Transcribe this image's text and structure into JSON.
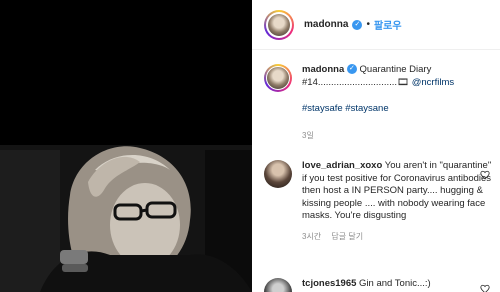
{
  "header": {
    "username": "madonna",
    "verified_mark": "✓",
    "separator": "•",
    "follow_label": "팔로우"
  },
  "caption": {
    "username": "madonna",
    "verified_mark": "✓",
    "text": "Quarantine Diary #14..............................",
    "emoji": "🎞",
    "mention": "@ncrfilms",
    "hashtags": "#staysafe #staysane",
    "time": "3일"
  },
  "comments": [
    {
      "username": "love_adrian_xoxo",
      "text": "You aren't in \"quarantine\" if you test positive for Coronavirus antibodies then host a IN PERSON party.... hugging & kissing people .... with nobody wearing face masks. You're disgusting",
      "time": "3시간",
      "reply_label": "답글 달기"
    },
    {
      "username": "tcjones1965",
      "text": "Gin and Tonic...:)"
    }
  ],
  "colors": {
    "accent": "#3897f0",
    "link": "#003569",
    "meta": "#8e8e8e"
  }
}
